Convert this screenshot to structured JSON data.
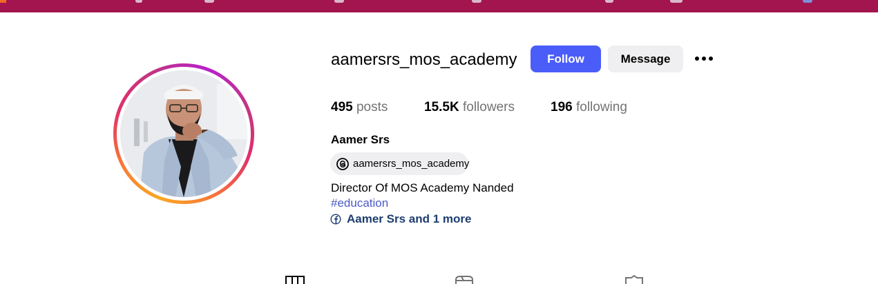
{
  "colors": {
    "browser_bar": "#a3154e",
    "follow_button": "#4a5df9",
    "secondary_button": "#efeff1",
    "hashtag": "#4a5ac8",
    "links": "#1c3d70",
    "muted": "#737373"
  },
  "profile": {
    "username": "aamersrs_mos_academy",
    "full_name": "Aamer Srs",
    "threads_handle": "aamersrs_mos_academy",
    "bio": "Director Of MOS Academy Nanded",
    "hashtag": "#education",
    "links_text": "Aamer Srs and 1 more"
  },
  "actions": {
    "follow_label": "Follow",
    "message_label": "Message",
    "more_icon": "more-horizontal-icon"
  },
  "stats": {
    "posts_count": "495",
    "posts_label": "posts",
    "followers_count": "15.5K",
    "followers_label": "followers",
    "following_count": "196",
    "following_label": "following"
  },
  "icons": {
    "threads": "threads-icon",
    "facebook": "facebook-icon",
    "posts_tab": "grid-icon",
    "reels_tab": "reels-icon",
    "tagged_tab": "tagged-icon"
  }
}
